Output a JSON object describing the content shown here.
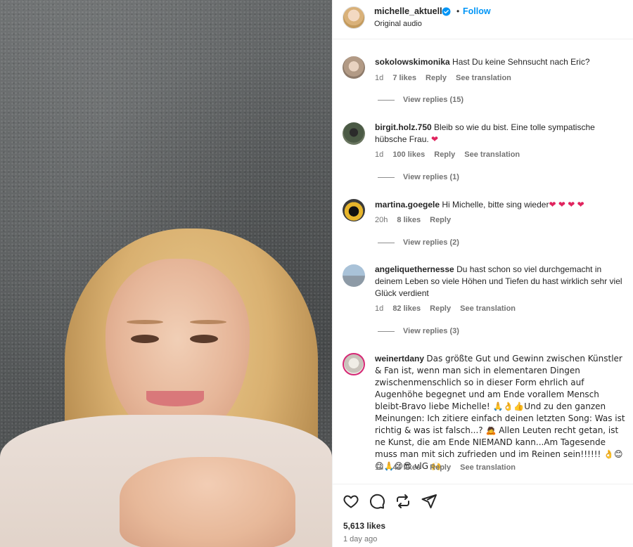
{
  "post": {
    "username": "michelle_aktuell",
    "dot": "•",
    "follow_label": "Follow",
    "audio": "Original audio",
    "likes": "5,613 likes",
    "posted": "1 day ago"
  },
  "comments": [
    {
      "user": "sokolowskimonika",
      "text": "Hast Du keine Sehnsucht nach Eric?",
      "time": "1d",
      "likes": "7 likes",
      "reply": "Reply",
      "translate": "See translation",
      "view_replies": "View replies (15)"
    },
    {
      "user": "birgit.holz.750",
      "text": "Bleib so wie du bist. Eine tolle sympatische hübsche Frau. ❤",
      "time": "1d",
      "likes": "100 likes",
      "reply": "Reply",
      "translate": "See translation",
      "view_replies": "View replies (1)"
    },
    {
      "user": "martina.goegele",
      "text": "Hi Michelle, bitte sing wieder❤ ❤ ❤ ❤",
      "time": "20h",
      "likes": "8 likes",
      "reply": "Reply",
      "view_replies": "View replies (2)"
    },
    {
      "user": "angeliquethernesse",
      "text": "Du hast schon so viel durchgemacht in deinem Leben so viele Höhen und Tiefen du hast wirklich sehr viel Glück verdient",
      "time": "1d",
      "likes": "82 likes",
      "reply": "Reply",
      "translate": "See translation",
      "view_replies": "View replies (3)"
    },
    {
      "user": "weinertdany",
      "text": "Das größte Gut und Gewinn zwischen Künstler & Fan ist, wenn man sich in elementaren Dingen zwischenmenschlich so in dieser Form ehrlich auf Augenhöhe begegnet und am Ende vorallem Mensch bleibt-Bravo liebe Michelle! 🙏👌👍Und zu den ganzen Meinungen: Ich zitiere einfach deinen letzten Song: Was ist richtig & was ist falsch...? 🙇 Allen Leuten recht getan, ist ne Kunst, die am Ende NIEMAND kann...Am Tagesende muss man mit sich zufrieden und im Reinen sein!!!!!! 👌😊😊🙏😊😎 vlG 🙌",
      "time": "1d",
      "likes": "44 likes",
      "reply": "Reply",
      "translate": "See translation"
    }
  ],
  "icons": {
    "like": "heart-outline",
    "comment": "speech-bubble",
    "repost": "repost-arrows",
    "share": "paper-plane",
    "verified": "blue-check-badge"
  },
  "colors": {
    "accent": "#0095f6",
    "muted": "#737373",
    "heart": "#e0245e"
  }
}
